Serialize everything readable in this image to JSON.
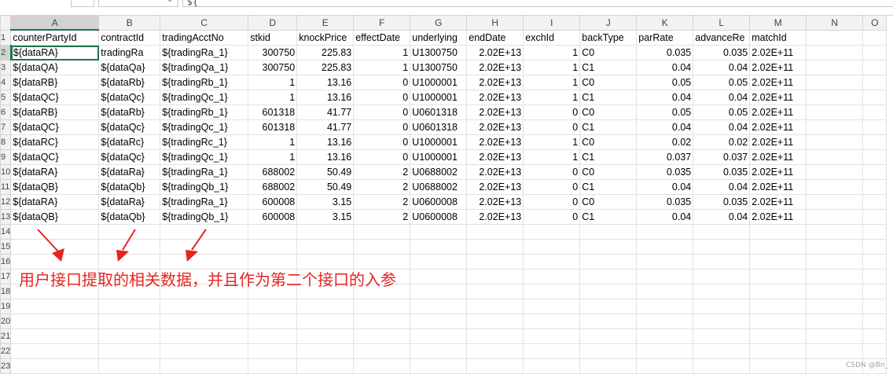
{
  "formula_bar": {
    "content": "${",
    "dropdown_icon": "chevron-down-icon"
  },
  "columns": [
    "A",
    "B",
    "C",
    "D",
    "E",
    "F",
    "G",
    "H",
    "I",
    "J",
    "K",
    "L",
    "M",
    "N",
    "O"
  ],
  "row_labels": [
    "1",
    "2",
    "3",
    "4",
    "5",
    "6",
    "7",
    "8",
    "9",
    "10",
    "11",
    "12",
    "13",
    "14",
    "15",
    "16",
    "17",
    "18",
    "19",
    "20",
    "21",
    "22",
    "23"
  ],
  "header_row": [
    "counterPartyId",
    "contractId",
    "tradingAcctNo",
    "stkid",
    "knockPrice",
    "effectDate",
    "underlying",
    "endDate",
    "exchId",
    "backType",
    "parRate",
    "advanceRe",
    "matchId",
    "",
    ""
  ],
  "rows": [
    [
      "${dataRA}",
      "tradingRa",
      "${tradingRa_1}",
      "300750",
      "225.83",
      "1",
      "U1300750",
      "2.02E+13",
      "1",
      "C0",
      "0.035",
      "0.035",
      "2.02E+11",
      "",
      ""
    ],
    [
      "${dataQA}",
      "${dataQa}",
      "${tradingQa_1}",
      "300750",
      "225.83",
      "1",
      "U1300750",
      "2.02E+13",
      "1",
      "C1",
      "0.04",
      "0.04",
      "2.02E+11",
      "",
      ""
    ],
    [
      "${dataRB}",
      "${dataRb}",
      "${tradingRb_1}",
      "1",
      "13.16",
      "0",
      "U1000001",
      "2.02E+13",
      "1",
      "C0",
      "0.05",
      "0.05",
      "2.02E+11",
      "",
      ""
    ],
    [
      "${dataQC}",
      "${dataQc}",
      "${tradingQc_1}",
      "1",
      "13.16",
      "0",
      "U1000001",
      "2.02E+13",
      "1",
      "C1",
      "0.04",
      "0.04",
      "2.02E+11",
      "",
      ""
    ],
    [
      "${dataRB}",
      "${dataRb}",
      "${tradingRb_1}",
      "601318",
      "41.77",
      "0",
      "U0601318",
      "2.02E+13",
      "0",
      "C0",
      "0.05",
      "0.05",
      "2.02E+11",
      "",
      ""
    ],
    [
      "${dataQC}",
      "${dataQc}",
      "${tradingQc_1}",
      "601318",
      "41.77",
      "0",
      "U0601318",
      "2.02E+13",
      "0",
      "C1",
      "0.04",
      "0.04",
      "2.02E+11",
      "",
      ""
    ],
    [
      "${dataRC}",
      "${dataRc}",
      "${tradingRc_1}",
      "1",
      "13.16",
      "0",
      "U1000001",
      "2.02E+13",
      "1",
      "C0",
      "0.02",
      "0.02",
      "2.02E+11",
      "",
      ""
    ],
    [
      "${dataQC}",
      "${dataQc}",
      "${tradingQc_1}",
      "1",
      "13.16",
      "0",
      "U1000001",
      "2.02E+13",
      "1",
      "C1",
      "0.037",
      "0.037",
      "2.02E+11",
      "",
      ""
    ],
    [
      "${dataRA}",
      "${dataRa}",
      "${tradingRa_1}",
      "688002",
      "50.49",
      "2",
      "U0688002",
      "2.02E+13",
      "0",
      "C0",
      "0.035",
      "0.035",
      "2.02E+11",
      "",
      ""
    ],
    [
      "${dataQB}",
      "${dataQb}",
      "${tradingQb_1}",
      "688002",
      "50.49",
      "2",
      "U0688002",
      "2.02E+13",
      "0",
      "C1",
      "0.04",
      "0.04",
      "2.02E+11",
      "",
      ""
    ],
    [
      "${dataRA}",
      "${dataRa}",
      "${tradingRa_1}",
      "600008",
      "3.15",
      "2",
      "U0600008",
      "2.02E+13",
      "0",
      "C0",
      "0.035",
      "0.035",
      "2.02E+11",
      "",
      ""
    ],
    [
      "${dataQB}",
      "${dataQb}",
      "${tradingQb_1}",
      "600008",
      "3.15",
      "2",
      "U0600008",
      "2.02E+13",
      "0",
      "C1",
      "0.04",
      "0.04",
      "2.02E+11",
      "",
      ""
    ]
  ],
  "numeric_columns": [
    3,
    4,
    5,
    7,
    8,
    10,
    11
  ],
  "annotation": {
    "text": "用户接口提取的相关数据，并且作为第二个接口的入参",
    "color": "#e8231f"
  },
  "watermark": "CSDN @Bn_"
}
